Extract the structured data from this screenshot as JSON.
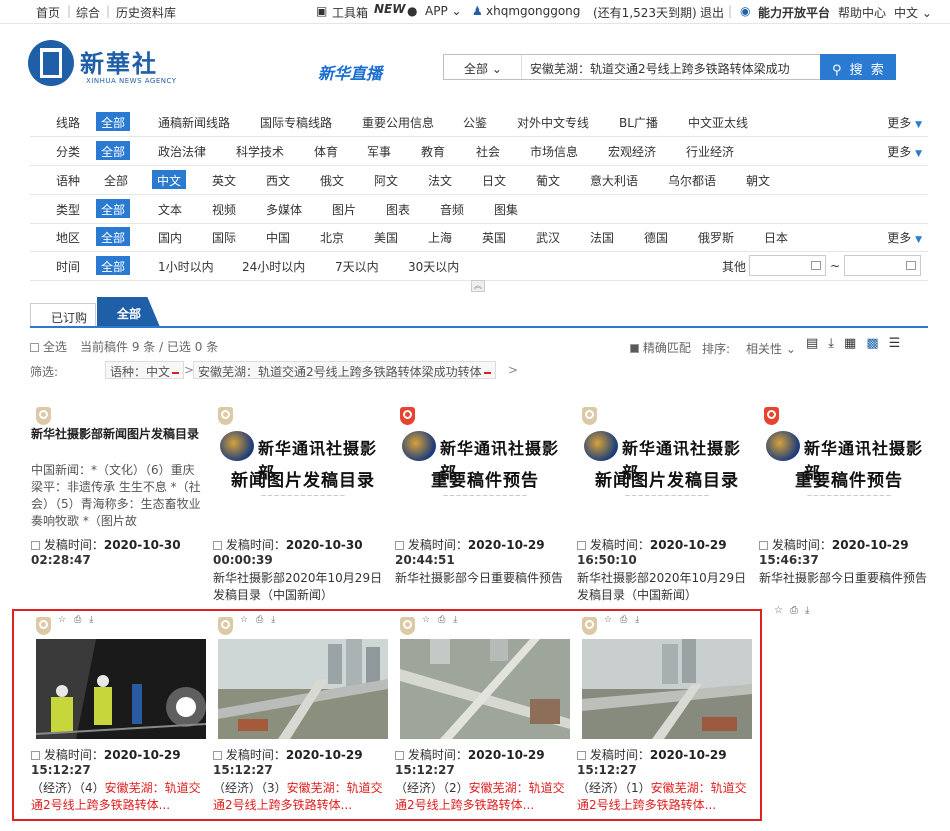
{
  "topbar": {
    "home": "首页",
    "general": "综合",
    "history": "历史资料库",
    "toolbox": "工具箱",
    "toolbox_badge": "NEW",
    "app": "APP",
    "username": "xhqmgonggong",
    "days_left": "(还有1,523天到期)",
    "logout": "退出",
    "open_platform": "能力开放平台",
    "help": "帮助中心",
    "language": "中文"
  },
  "header": {
    "logo_cn": "新華社",
    "logo_en": "XINHUA NEWS AGENCY",
    "live": "新华直播",
    "search_scope": "全部",
    "search_value": "安徽芜湖：轨道交通2号线上跨多铁路转体梁成功",
    "search_button": "搜 索"
  },
  "filters": {
    "more": "更多",
    "line": {
      "label": "线路",
      "selected": "全部",
      "options": [
        "通稿新闻线路",
        "国际专稿线路",
        "重要公用信息",
        "公鉴",
        "对外中文专线",
        "BL广播",
        "中文亚太线"
      ]
    },
    "category": {
      "label": "分类",
      "selected": "全部",
      "options": [
        "政治法律",
        "科学技术",
        "体育",
        "军事",
        "教育",
        "社会",
        "市场信息",
        "宏观经济",
        "行业经济"
      ]
    },
    "language": {
      "label": "语种",
      "first": "全部",
      "selected": "中文",
      "options": [
        "英文",
        "西文",
        "俄文",
        "阿文",
        "法文",
        "日文",
        "葡文",
        "意大利语",
        "乌尔都语",
        "朝文"
      ]
    },
    "type": {
      "label": "类型",
      "selected": "全部",
      "options": [
        "文本",
        "视频",
        "多媒体",
        "图片",
        "图表",
        "音频",
        "图集"
      ]
    },
    "region": {
      "label": "地区",
      "selected": "全部",
      "options": [
        "国内",
        "国际",
        "中国",
        "北京",
        "美国",
        "上海",
        "英国",
        "武汉",
        "法国",
        "德国",
        "俄罗斯",
        "日本"
      ]
    },
    "time": {
      "label": "时间",
      "selected": "全部",
      "options": [
        "1小时以内",
        "24小时以内",
        "7天以内",
        "30天以内"
      ],
      "other": "其他",
      "range_sep": "~"
    }
  },
  "tabs": {
    "subscribed": "已订购",
    "all": "全部"
  },
  "results": {
    "select_all": "全选",
    "summary": "当前稿件 9 条 / 已选 0 条",
    "exact_match": "精确匹配",
    "sort_label": "排序:",
    "sort_value": "相关性",
    "filter_label": "筛选:",
    "filter_lang": "语种：中文",
    "filter_keyword": "安徽芜湖：轨道交通2号线上跨多铁路转体梁成功转体"
  },
  "cards": [
    {
      "badge": "beige",
      "text_title": "新华社摄影部新闻图片发稿目录",
      "text_body": "中国新闻：*（文化）（6）重庆梁平：非遗传承 生生不息 *（社会）（5）青海称多：生态畜牧业奏响牧歌 *（图片故",
      "date": "2020-10-30",
      "time": "02:28:47",
      "title": "",
      "red": false
    },
    {
      "badge": "beige",
      "poster_title": "新华通讯社摄影部",
      "poster_mid": "新闻图片发稿目录",
      "date": "2020-10-30",
      "time": "00:00:39",
      "title": "新华社摄影部2020年10月29日发稿目录（中国新闻）",
      "red": false
    },
    {
      "badge": "red",
      "poster_title": "新华通讯社摄影部",
      "poster_mid": "重要稿件预告",
      "date": "2020-10-29",
      "time": "20:44:51",
      "title": "新华社摄影部今日重要稿件预告",
      "red": false
    },
    {
      "badge": "beige",
      "poster_title": "新华通讯社摄影部",
      "poster_mid": "新闻图片发稿目录",
      "date": "2020-10-29",
      "time": "16:50:10",
      "title": "新华社摄影部2020年10月29日发稿目录（中国新闻）",
      "red": false
    },
    {
      "badge": "red",
      "poster_title": "新华通讯社摄影部",
      "poster_mid": "重要稿件预告",
      "date": "2020-10-29",
      "time": "15:46:37",
      "title": "新华社摄影部今日重要稿件预告",
      "red": false
    },
    {
      "badge": "beige",
      "date": "2020-10-29",
      "time": "15:12:27",
      "title_prefix": "（经济）（4）",
      "title": "安徽芜湖：轨道交通2号线上跨多铁路转体...",
      "red": true
    },
    {
      "badge": "beige",
      "date": "2020-10-29",
      "time": "15:12:27",
      "title_prefix": "（经济）（3）",
      "title": "安徽芜湖：轨道交通2号线上跨多铁路转体...",
      "red": true
    },
    {
      "badge": "beige",
      "date": "2020-10-29",
      "time": "15:12:27",
      "title_prefix": "（经济）（2）",
      "title": "安徽芜湖：轨道交通2号线上跨多铁路转体...",
      "red": true
    },
    {
      "badge": "beige",
      "date": "2020-10-29",
      "time": "15:12:27",
      "title_prefix": "（经济）（1）",
      "title": "安徽芜湖：轨道交通2号线上跨多铁路转体...",
      "red": true
    }
  ],
  "date_label": "发稿时间：",
  "colors": {
    "accent": "#2a7ad2",
    "brand": "#1f5fa8",
    "highlight": "#e02020"
  }
}
